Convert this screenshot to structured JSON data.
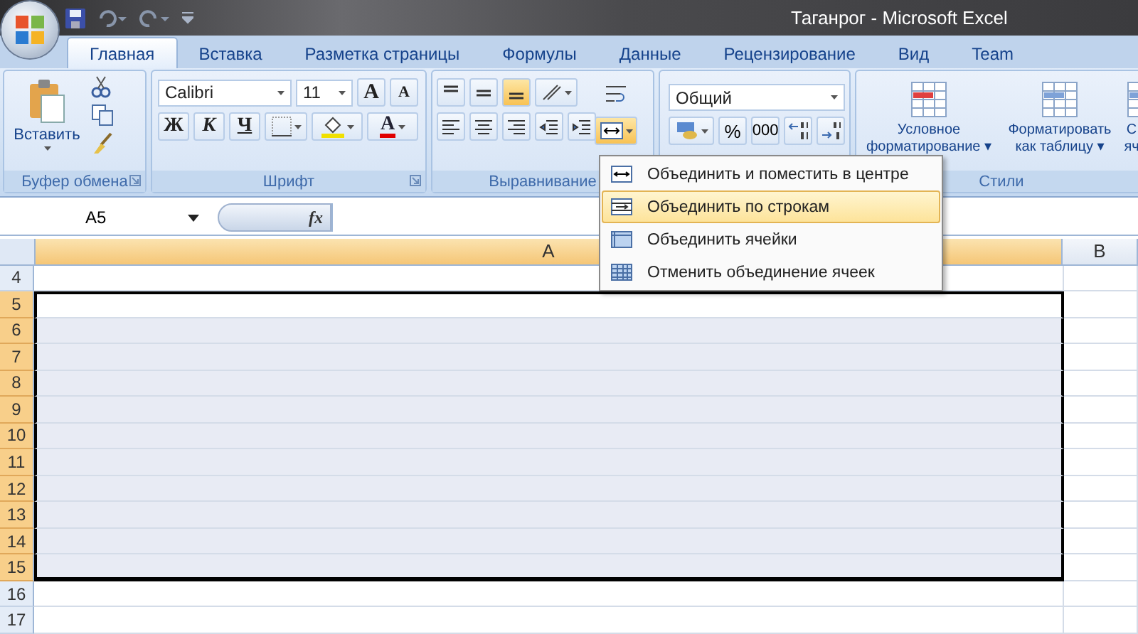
{
  "window": {
    "title": "Таганрог - Microsoft Excel"
  },
  "tabs": [
    {
      "label": "Главная",
      "selected": true
    },
    {
      "label": "Вставка",
      "selected": false
    },
    {
      "label": "Разметка страницы",
      "selected": false
    },
    {
      "label": "Формулы",
      "selected": false
    },
    {
      "label": "Данные",
      "selected": false
    },
    {
      "label": "Рецензирование",
      "selected": false
    },
    {
      "label": "Вид",
      "selected": false
    },
    {
      "label": "Team",
      "selected": false
    }
  ],
  "ribbon": {
    "clipboard": {
      "paste": "Вставить",
      "label": "Буфер обмена"
    },
    "font": {
      "name": "Calibri",
      "size": "11",
      "grow": "A",
      "shrink": "A",
      "bold": "Ж",
      "italic": "К",
      "underline": "Ч",
      "color_letter": "A",
      "label": "Шрифт"
    },
    "alignment": {
      "label": "Выравнивание",
      "merge_open": true
    },
    "number": {
      "format": "Общий",
      "percent": "%",
      "thousands": "000"
    },
    "styles": {
      "buttons": [
        {
          "lines": [
            "Условное",
            "форматирование ▾"
          ]
        },
        {
          "lines": [
            "Форматировать",
            "как таблицу ▾"
          ]
        },
        {
          "lines": [
            "С",
            "яч"
          ]
        }
      ],
      "label": "Стили"
    }
  },
  "formula_bar": {
    "name_box": "A5",
    "fx": "fx"
  },
  "sheet": {
    "columns": [
      {
        "label": "A",
        "selected": true
      },
      {
        "label": "B",
        "selected": false
      }
    ],
    "rows": [
      {
        "number": "4",
        "selected": false,
        "active": false
      },
      {
        "number": "5",
        "selected": true,
        "active": true
      },
      {
        "number": "6",
        "selected": true,
        "active": false
      },
      {
        "number": "7",
        "selected": true,
        "active": false
      },
      {
        "number": "8",
        "selected": true,
        "active": false
      },
      {
        "number": "9",
        "selected": true,
        "active": false
      },
      {
        "number": "10",
        "selected": true,
        "active": false
      },
      {
        "number": "11",
        "selected": true,
        "active": false
      },
      {
        "number": "12",
        "selected": true,
        "active": false
      },
      {
        "number": "13",
        "selected": true,
        "active": false
      },
      {
        "number": "14",
        "selected": true,
        "active": false
      },
      {
        "number": "15",
        "selected": true,
        "active": false
      },
      {
        "number": "16",
        "selected": false,
        "active": false
      },
      {
        "number": "17",
        "selected": false,
        "active": false
      }
    ]
  },
  "merge_menu": {
    "items": [
      {
        "label": "Объединить и поместить в центре",
        "selected": false,
        "kind": "center"
      },
      {
        "label": "Объединить по строкам",
        "selected": true,
        "kind": "across"
      },
      {
        "label": "Объединить ячейки",
        "selected": false,
        "kind": "merge"
      },
      {
        "label": "Отменить объединение ячеек",
        "selected": false,
        "kind": "unmerge"
      }
    ]
  }
}
